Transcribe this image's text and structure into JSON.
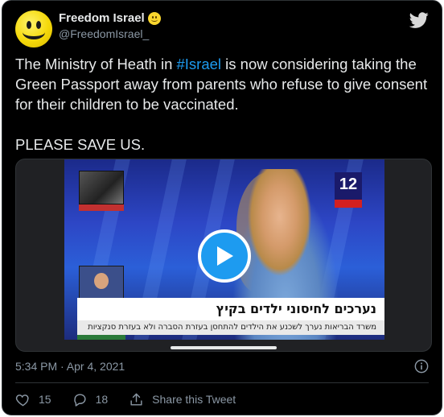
{
  "tweet": {
    "display_name": "Freedom Israel",
    "handle": "@FreedomIsrael_",
    "text_before_hashtag": "The Ministry of Heath in ",
    "hashtag": "#Israel",
    "text_after_hashtag": " is now considering taking the Green Passport away from parents who refuse to give consent for their children to be vaccinated.\n\nPLEASE SAVE US.",
    "timestamp": "5:34 PM · Apr 4, 2021"
  },
  "media": {
    "channel_number": "12",
    "caption_main": "נערכים לחיסוני ילדים בקיץ",
    "caption_sub": "משרד הבריאות נערך לשכנע את הילדים להתחסן בעזרת הסברה ולא בעזרת סנקציות"
  },
  "actions": {
    "like_count": "15",
    "reply_count": "18",
    "share_label": "Share this Tweet"
  },
  "icons": {
    "avatar": "smiley-face-icon",
    "verified_emoji": "slightly-smiling-emoji-icon",
    "brand": "twitter-bird-icon",
    "play": "play-icon",
    "info": "info-icon",
    "like": "heart-icon",
    "reply": "reply-bubble-icon",
    "share": "share-icon"
  },
  "colors": {
    "background": "#000000",
    "link": "#1d9bf0",
    "text": "#e7e9ea",
    "muted": "#8b98a5"
  }
}
